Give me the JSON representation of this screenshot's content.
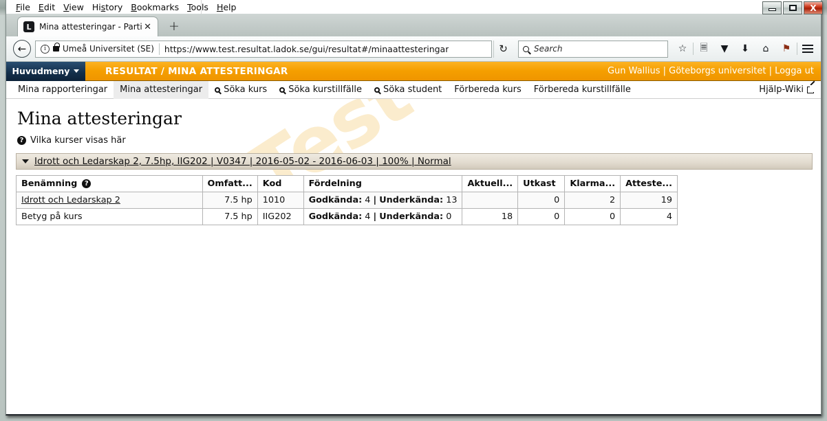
{
  "window": {
    "minimize_label": "minimize",
    "maximize_label": "maximize",
    "close_label": "X"
  },
  "menubar": {
    "items": [
      {
        "label": "File",
        "mnemonic": "F"
      },
      {
        "label": "Edit",
        "mnemonic": "E"
      },
      {
        "label": "View",
        "mnemonic": "V"
      },
      {
        "label": "History",
        "mnemonic": "s"
      },
      {
        "label": "Bookmarks",
        "mnemonic": "B"
      },
      {
        "label": "Tools",
        "mnemonic": "T"
      },
      {
        "label": "Help",
        "mnemonic": "H"
      }
    ]
  },
  "browser": {
    "tab": {
      "favicon_letter": "L",
      "title": "Mina attesteringar - Partici...",
      "close_label": "✕"
    },
    "new_tab_label": "+",
    "back_label": "←",
    "site_identity": "Umeå Universitet (SE)",
    "url": "https://www.test.resultat.ladok.se/gui/resultat#/minaattesteringar",
    "reload_label": "↻",
    "search_placeholder": "Search",
    "search_value": "",
    "toolbar_icons": [
      {
        "name": "bookmark-star-icon",
        "glyph": "☆"
      },
      {
        "name": "reader-list-icon",
        "glyph": "☰"
      },
      {
        "name": "pocket-icon",
        "glyph": "⬟"
      },
      {
        "name": "download-icon",
        "glyph": "⬇"
      },
      {
        "name": "home-icon",
        "glyph": "⌂"
      },
      {
        "name": "extension-icon",
        "glyph": "⚑"
      },
      {
        "name": "menu-hamburger-icon",
        "glyph": "☰"
      }
    ]
  },
  "app": {
    "main_menu_label": "Huvudmeny",
    "breadcrumb": "RESULTAT / MINA ATTESTERINGAR",
    "user": "Gun Wallius",
    "organisation": "Göteborgs universitet",
    "logout_label": "Logga ut",
    "user_line": "Gun Wallius | Göteborgs universitet | Logga ut",
    "nav_tabs": [
      {
        "label": "Mina rapporteringar",
        "icon": "",
        "active": false
      },
      {
        "label": "Mina attesteringar",
        "icon": "",
        "active": true
      },
      {
        "label": "Söka kurs",
        "icon": "search-icon",
        "active": false
      },
      {
        "label": "Söka kurstillfälle",
        "icon": "search-icon",
        "active": false
      },
      {
        "label": "Söka student",
        "icon": "search-icon",
        "active": false
      },
      {
        "label": "Förbereda kurs",
        "icon": "",
        "active": false
      },
      {
        "label": "Förbereda kurstillfälle",
        "icon": "",
        "active": false
      }
    ],
    "help_wiki_label": "Hjälp-Wiki",
    "watermark": "Test Resultat"
  },
  "page": {
    "title": "Mina attesteringar",
    "help_link": "Vilka kurser visas här",
    "accordion": {
      "expanded": true,
      "label": "Idrott och Ledarskap 2, 7.5hp, IIG202 | V0347 | 2016-05-02 - 2016-06-03 | 100% | Normal"
    },
    "table": {
      "headers": [
        {
          "label": "Benämning",
          "help": true,
          "align": "left"
        },
        {
          "label": "Omfatt...",
          "help": false,
          "align": "right"
        },
        {
          "label": "Kod",
          "help": false,
          "align": "left"
        },
        {
          "label": "Fördelning",
          "help": false,
          "align": "left"
        },
        {
          "label": "Aktuell...",
          "help": false,
          "align": "right"
        },
        {
          "label": "Utkast",
          "help": false,
          "align": "right"
        },
        {
          "label": "Klarma...",
          "help": false,
          "align": "right"
        },
        {
          "label": "Atteste...",
          "help": false,
          "align": "right"
        }
      ],
      "rows": [
        {
          "benamning": "Idrott och Ledarskap 2",
          "benamning_is_link": true,
          "omfattning": "7.5 hp",
          "kod": "1010",
          "fordelning_godkanda_label": "Godkända:",
          "fordelning_godkanda_value": "4",
          "fordelning_underkanda_label": "Underkända:",
          "fordelning_underkanda_value": "13",
          "aktuell": "",
          "utkast": "0",
          "klarmarkerade": "2",
          "attesterade": "19"
        },
        {
          "benamning": "Betyg på kurs",
          "benamning_is_link": false,
          "omfattning": "7.5 hp",
          "kod": "IIG202",
          "fordelning_godkanda_label": "Godkända:",
          "fordelning_godkanda_value": "4",
          "fordelning_underkanda_label": "Underkända:",
          "fordelning_underkanda_value": "0",
          "aktuell": "18",
          "utkast": "0",
          "klarmarkerade": "0",
          "attesterade": "4"
        }
      ]
    }
  },
  "colors": {
    "accent_orange": "#f59f00",
    "menu_navy": "#14304c",
    "accordion_beige": "#e3dcd0",
    "watermark": "#fbeccd"
  }
}
